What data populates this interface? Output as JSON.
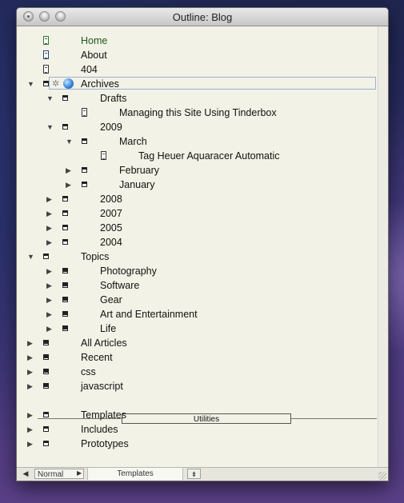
{
  "window": {
    "title": "Outline: Blog"
  },
  "outline": {
    "rows": [
      {
        "label": "Home"
      },
      {
        "label": "About"
      },
      {
        "label": "404"
      },
      {
        "label": "Archives"
      },
      {
        "label": "Drafts"
      },
      {
        "label": "Managing this Site Using Tinderbox"
      },
      {
        "label": "2009"
      },
      {
        "label": "March"
      },
      {
        "label": "Tag Heuer Aquaracer Automatic"
      },
      {
        "label": "February"
      },
      {
        "label": "January"
      },
      {
        "label": "2008"
      },
      {
        "label": "2007"
      },
      {
        "label": "2005"
      },
      {
        "label": "2004"
      },
      {
        "label": "Topics"
      },
      {
        "label": "Photography"
      },
      {
        "label": "Software"
      },
      {
        "label": "Gear"
      },
      {
        "label": "Art and Entertainment"
      },
      {
        "label": "Life"
      },
      {
        "label": "All Articles"
      },
      {
        "label": "Recent"
      },
      {
        "label": "css"
      },
      {
        "label": "javascript"
      },
      {
        "label": "Templates"
      },
      {
        "label": "Includes"
      },
      {
        "label": "Prototypes"
      }
    ],
    "separator_label": "Utilities"
  },
  "statusbar": {
    "mode": "Normal",
    "tab": "Templates"
  },
  "icons": {
    "disclosure_collapsed": "triangle-right-icon",
    "disclosure_expanded": "triangle-down-icon",
    "note": "note-icon",
    "container": "container-icon",
    "globe": "globe-icon",
    "gear": "gear-icon"
  }
}
